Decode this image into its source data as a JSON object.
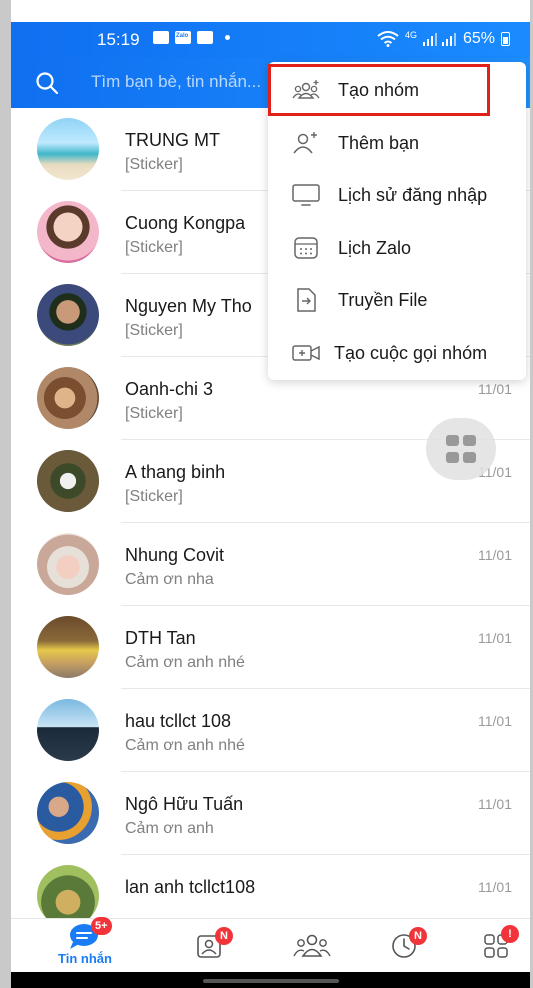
{
  "status_bar": {
    "time": "15:19",
    "network": "4G",
    "battery": "65%"
  },
  "search": {
    "placeholder": "Tìm bạn bè, tin nhắn..."
  },
  "menu": {
    "items": [
      {
        "label": "Tạo nhóm",
        "icon": "create-group-icon"
      },
      {
        "label": "Thêm bạn",
        "icon": "add-friend-icon"
      },
      {
        "label": "Lịch sử đăng nhập",
        "icon": "monitor-icon"
      },
      {
        "label": "Lịch Zalo",
        "icon": "calendar-icon"
      },
      {
        "label": "Truyền File",
        "icon": "file-transfer-icon"
      },
      {
        "label": "Tạo cuộc gọi nhóm",
        "icon": "video-call-icon"
      }
    ]
  },
  "chats": [
    {
      "name": "TRUNG MT",
      "preview": "[Sticker]",
      "time": ""
    },
    {
      "name": "Cuong Kongpa",
      "preview": "[Sticker]",
      "time": ""
    },
    {
      "name": "Nguyen My Tho",
      "preview": "[Sticker]",
      "time": ""
    },
    {
      "name": "Oanh-chi 3",
      "preview": "[Sticker]",
      "time": "11/01"
    },
    {
      "name": "A thang binh",
      "preview": "[Sticker]",
      "time": "11/01"
    },
    {
      "name": "Nhung Covit",
      "preview": "Cảm ơn nha",
      "time": "11/01"
    },
    {
      "name": "DTH Tan",
      "preview": "Cảm ơn anh nhé",
      "time": "11/01"
    },
    {
      "name": "hau tcllct 108",
      "preview": "Cảm ơn anh nhé",
      "time": "11/01"
    },
    {
      "name": "Ngô Hữu Tuấn",
      "preview": "Cảm ơn anh",
      "time": "11/01"
    },
    {
      "name": "lan anh tcllct108",
      "preview": "",
      "time": "11/01"
    }
  ],
  "bottom_nav": {
    "messages_label": "Tin nhắn",
    "messages_badge": "5+",
    "contacts_badge": "N",
    "timeline_badge": "N",
    "more_badge": "!"
  },
  "colors": {
    "brand": "#1a7cf5",
    "badge": "#f0343a",
    "highlight": "#e0201a"
  }
}
